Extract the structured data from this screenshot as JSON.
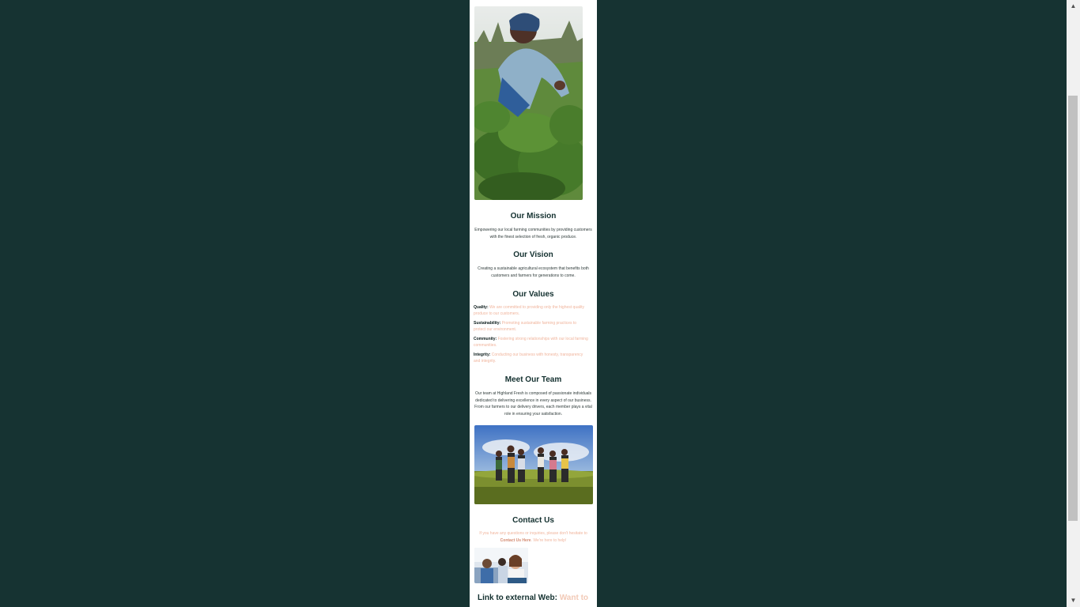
{
  "about": {
    "mission": {
      "title": "Our Mission",
      "text": "Empowering our local farming communities by providing customers with the finest selection of fresh, organic produce."
    },
    "vision": {
      "title": "Our Vision",
      "text": "Creating a sustainable agricultural ecosystem that benefits both customers and farmers for generations to come."
    },
    "values": {
      "title": "Our Values",
      "items": [
        {
          "label": "Quality:",
          "text": "We are committed to providing only the highest quality produce to our customers."
        },
        {
          "label": "Sustainability:",
          "text": "Promoting sustainable farming practices to protect our environment."
        },
        {
          "label": "Community:",
          "text": "Fostering strong relationships with our local farming communities."
        },
        {
          "label": "Integrity:",
          "text": "Conducting our business with honesty, transparency and integrity."
        }
      ]
    },
    "team": {
      "title": "Meet Our Team",
      "text": "Our team at Highland Fresh is composed of passionate individuals dedicated to delivering excellence in every aspect of our business. From our farmers to our delivery drivers, each member plays a vital role in ensuring your satisfaction."
    },
    "contact": {
      "title": "Contact Us",
      "text_before": "If you have any questions or inquiries, please don't hesitate to",
      "link": "Contact Us Here",
      "text_after": ". We're here to help!"
    },
    "external": {
      "label": "Link to external Web:",
      "teaser": "Want to"
    }
  },
  "colors": {
    "page_background": "#163332",
    "heading": "#13302f",
    "accent": "#f0b49c"
  }
}
